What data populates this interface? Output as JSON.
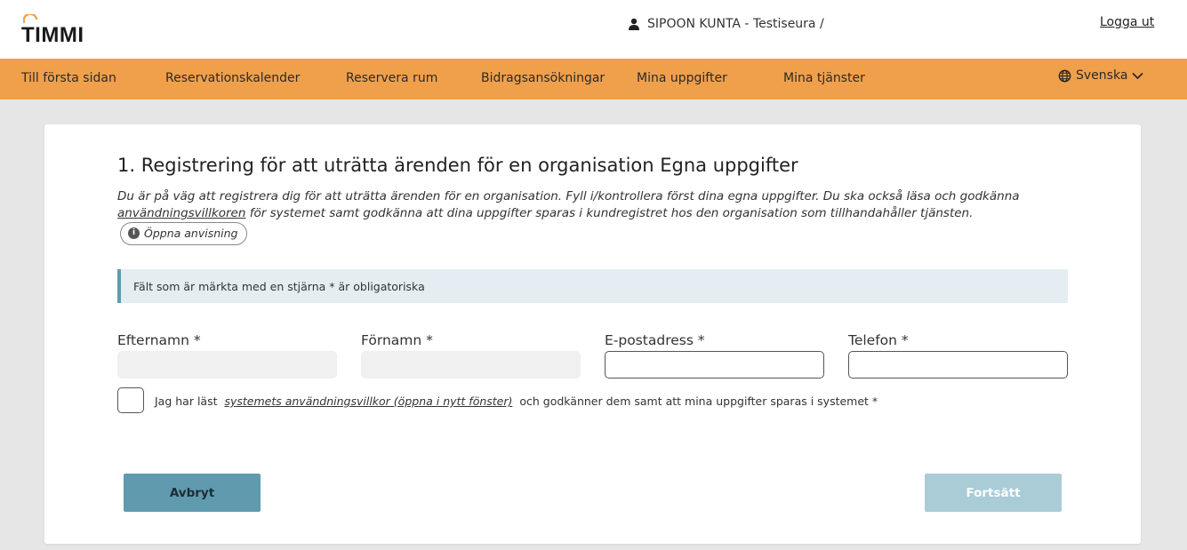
{
  "header": {
    "logo_text": "TIMMI",
    "user_label": "SIPOON KUNTA - Testiseura /",
    "logout_label": "Logga ut"
  },
  "nav": {
    "items": [
      {
        "label": "Till första sidan"
      },
      {
        "label": "Reservationskalender"
      },
      {
        "label": "Reservera rum"
      },
      {
        "label": "Bidragsansökningar"
      },
      {
        "label": "Mina uppgifter"
      },
      {
        "label": "Mina tjänster"
      }
    ],
    "language": "Svenska"
  },
  "form": {
    "title": "1. Registrering för att uträtta ärenden för en organisation Egna uppgifter",
    "intro_part1": "Du är på väg att registrera dig för att uträtta ärenden för en organisation. Fyll i/kontrollera först dina egna uppgifter. Du ska också läsa och godkänna ",
    "intro_link": "användningsvillkoren",
    "intro_part2": " för systemet samt godkänna att dina uppgifter sparas i kundregistret hos den organisation som tillhandahåller tjänsten.",
    "open_instructions_label": "Öppna anvisning",
    "required_notice": "Fält som är märkta med en stjärna * är obligatoriska",
    "fields": [
      {
        "label": "Efternamn *",
        "value": ""
      },
      {
        "label": "Förnamn *",
        "value": ""
      },
      {
        "label": "E-postadress *",
        "value": ""
      },
      {
        "label": "Telefon *",
        "value": ""
      }
    ],
    "consent_prefix": "Jag har läst",
    "consent_link": "systemets användningsvillkor (öppna i nytt fönster)",
    "consent_suffix": "och godkänner dem samt att mina uppgifter sparas i systemet *",
    "consent_checked": false,
    "cancel_label": "Avbryt",
    "continue_label": "Fortsätt"
  },
  "colors": {
    "nav_bg": "#f0a04b",
    "primary_button": "#5f9aae",
    "disabled_button": "#a9ccd6",
    "notice_bg": "#e4edf1",
    "page_bg": "#e6e6e6"
  },
  "icons": {
    "logo_mark": "logo-arc-icon",
    "user": "user-icon",
    "language": "globe-icon",
    "language_toggle": "chevron-down-icon",
    "info": "info-icon"
  }
}
